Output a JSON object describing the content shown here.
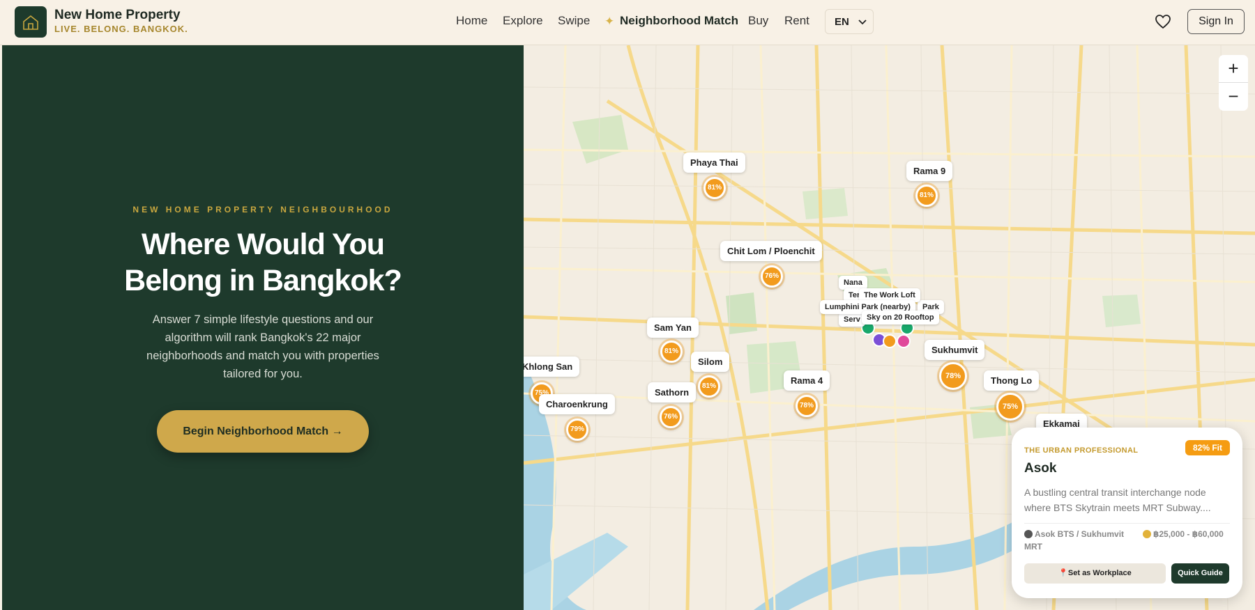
{
  "header": {
    "brand_name": "New Home Property",
    "brand_tagline": "LIVE. BELONG. BANGKOK.",
    "nav": [
      "Home",
      "Explore",
      "Swipe",
      "Neighborhood Match",
      "Buy",
      "Rent"
    ],
    "language": "EN",
    "sign_in": "Sign In"
  },
  "hero": {
    "eyebrow": "NEW HOME PROPERTY NEIGHBOURHOOD",
    "title_line1": "Where Would You",
    "title_line2": "Belong in Bangkok?",
    "description": "Answer 7 simple lifestyle questions and our algorithm will rank Bangkok's 22 major neighborhoods and match you with properties tailored for you.",
    "cta": "Begin Neighborhood Match →"
  },
  "map": {
    "zoom_in": "+",
    "zoom_out": "−",
    "neighborhoods": [
      {
        "name": "Phaya Thai",
        "score": "81%"
      },
      {
        "name": "Rama 9",
        "score": "81%"
      },
      {
        "name": "Chit Lom / Ploenchit",
        "score": "76%"
      },
      {
        "name": "Sam Yan",
        "score": "81%"
      },
      {
        "name": "Silom",
        "score": "81%"
      },
      {
        "name": "Sathorn",
        "score": "76%"
      },
      {
        "name": "Rama 4",
        "score": "78%"
      },
      {
        "name": "Sukhumvit",
        "score": "78%"
      },
      {
        "name": "Thong Lo",
        "score": "75%"
      },
      {
        "name": "Khlong San",
        "score": "75%"
      },
      {
        "name": "Charoenkrung",
        "score": "79%"
      },
      {
        "name": "Ekkamai",
        "score": ""
      }
    ],
    "poi_labels": [
      "Nana",
      "Ter",
      "The Work Loft",
      "Lumphini Park (nearby)",
      "Park",
      "Serv",
      "Sky on 20 Rooftop"
    ],
    "colors": {
      "pin": "#f29b1d",
      "poi_green": "#18a86b",
      "poi_purple": "#7b4fd6",
      "poi_pink": "#e0499a",
      "poi_orange": "#f29b1d"
    }
  },
  "card": {
    "eyebrow": "THE URBAN PROFESSIONAL",
    "fit": "82% Fit",
    "title": "Asok",
    "description": "A bustling central transit interchange node where BTS Skytrain meets MRT Subway....",
    "transit": "Asok BTS / Sukhumvit MRT",
    "price": "฿25,000 - ฿60,000",
    "btn_workplace": "Set as Workplace",
    "btn_guide": "Quick Guide"
  }
}
